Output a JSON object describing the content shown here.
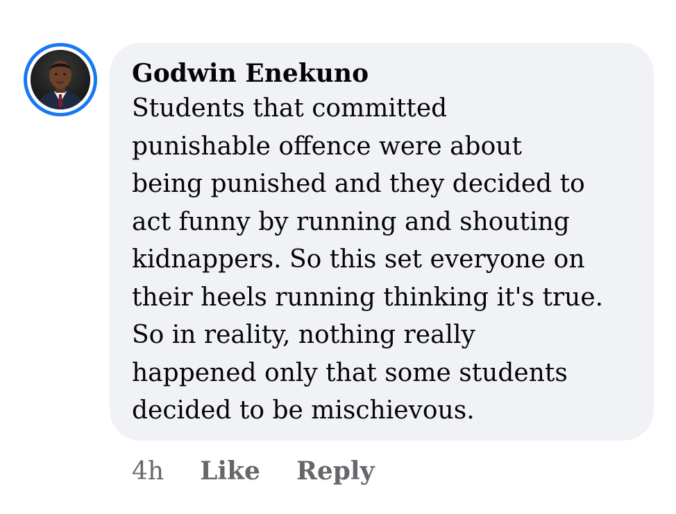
{
  "comment": {
    "author": "Godwin Enekuno",
    "text_lines": [
      "Students that committed",
      "punishable offence were about",
      "being punished and they decided to",
      "act funny by running and shouting",
      "kidnappers. So this set everyone on",
      "their heels running thinking it's true.",
      "So in reality, nothing really",
      "happened only that some students",
      "decided to be mischievous."
    ],
    "timestamp": "4h",
    "like_label": "Like",
    "reply_label": "Reply",
    "avatar_icon": "profile-photo-icon"
  },
  "colors": {
    "bubble": "#f0f2f5",
    "ring": "#1877f2",
    "meta": "#65676b"
  }
}
